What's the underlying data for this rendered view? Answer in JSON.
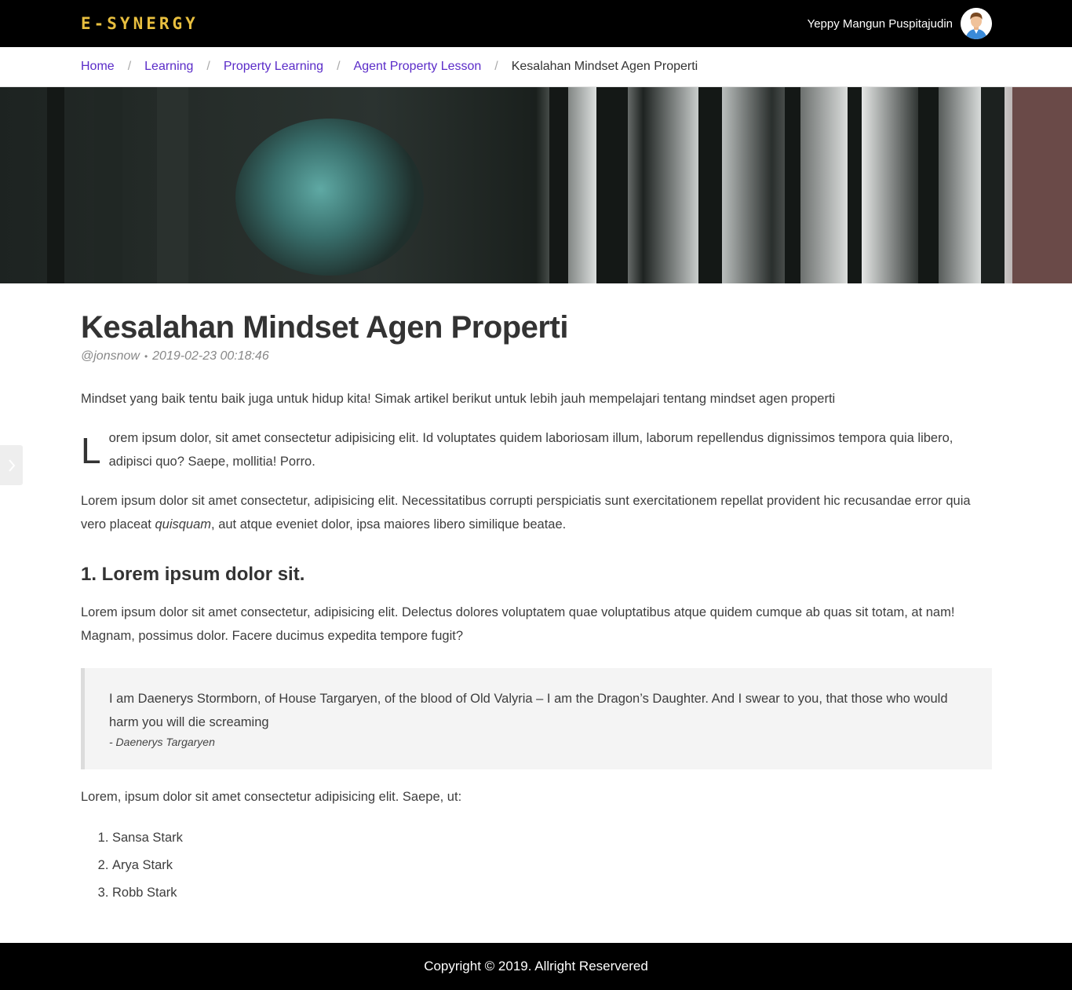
{
  "header": {
    "logo": "E-SYNERGY",
    "user_name": "Yeppy Mangun Puspitajudin",
    "avatar_icon": "user-avatar-icon"
  },
  "breadcrumb": {
    "items": [
      "Home",
      "Learning",
      "Property Learning",
      "Agent Property Lesson"
    ],
    "current": "Kesalahan Mindset Agen Properti",
    "separator": "/"
  },
  "article": {
    "title": "Kesalahan Mindset Agen Properti",
    "author": "@jonsnow",
    "date": "2019-02-23 00:18:46",
    "intro": "Mindset yang baik tentu baik juga untuk hidup kita! Simak artikel berikut untuk lebih jauh mempelajari tentang mindset agen properti",
    "dropcap_letter": "L",
    "para1_rest": "orem ipsum dolor, sit amet consectetur adipisicing elit. Id voluptates quidem laboriosam illum, laborum repellendus dignissimos tempora quia libero, adipisci quo? Saepe, mollitia! Porro.",
    "para2_before": "Lorem ipsum dolor sit amet consectetur, adipisicing elit. Necessitatibus corrupti perspiciatis sunt exercitationem repellat provident hic recusandae error quia vero placeat ",
    "para2_em": "quisquam",
    "para2_after": ", aut atque eveniet dolor, ipsa maiores libero similique beatae.",
    "heading1": "1. Lorem ipsum dolor sit.",
    "para3": "Lorem ipsum dolor sit amet consectetur, adipisicing elit. Delectus dolores voluptatem quae voluptatibus atque quidem cumque ab quas sit totam, at nam! Magnam, possimus dolor. Facere ducimus expedita tempore fugit?",
    "quote": {
      "text": "I am Daenerys Stormborn, of House Targaryen, of the blood of Old Valyria – I am the Dragon’s Daughter. And I swear to you, that those who would harm you will die screaming",
      "author": "- Daenerys Targaryen"
    },
    "para4": "Lorem, ipsum dolor sit amet consectetur adipisicing elit. Saepe, ut:",
    "list": [
      "Sansa Stark",
      "Arya Stark",
      "Robb Stark"
    ]
  },
  "sidebar_toggle_icon": "chevron-right-icon",
  "footer": {
    "copyright": "Copyright © 2019. Allright Reservered"
  },
  "colors": {
    "accent_logo": "#e8bf3f",
    "link": "#5a2bc8",
    "topbar_bg": "#000000"
  }
}
